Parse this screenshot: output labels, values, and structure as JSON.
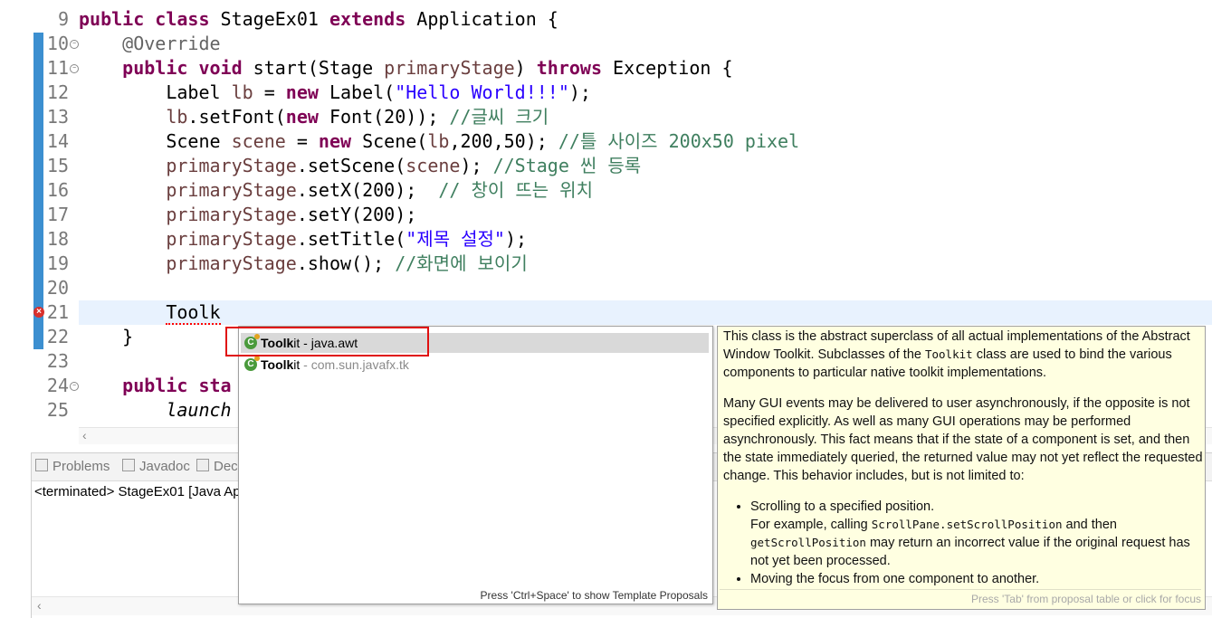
{
  "editor": {
    "lines": [
      {
        "num": "9",
        "segs": [
          {
            "t": "public class",
            "c": "kw"
          },
          {
            "t": " StageEx01 "
          },
          {
            "t": "extends",
            "c": "kw"
          },
          {
            "t": " Application {"
          }
        ]
      },
      {
        "num": "10",
        "segs": [
          {
            "t": "    "
          },
          {
            "t": "@Override",
            "c": "ann"
          }
        ]
      },
      {
        "num": "11",
        "segs": [
          {
            "t": "    "
          },
          {
            "t": "public void",
            "c": "kw"
          },
          {
            "t": " start(Stage "
          },
          {
            "t": "primaryStage",
            "c": "var"
          },
          {
            "t": ") "
          },
          {
            "t": "throws",
            "c": "kw"
          },
          {
            "t": " Exception {"
          }
        ]
      },
      {
        "num": "12",
        "segs": [
          {
            "t": "        Label "
          },
          {
            "t": "lb",
            "c": "var"
          },
          {
            "t": " = "
          },
          {
            "t": "new",
            "c": "kw"
          },
          {
            "t": " Label("
          },
          {
            "t": "\"Hello World!!!\"",
            "c": "str"
          },
          {
            "t": ");"
          }
        ]
      },
      {
        "num": "13",
        "segs": [
          {
            "t": "        "
          },
          {
            "t": "lb",
            "c": "var"
          },
          {
            "t": ".setFont("
          },
          {
            "t": "new",
            "c": "kw"
          },
          {
            "t": " Font(20)); "
          },
          {
            "t": "//글씨 크기",
            "c": "cmt"
          }
        ]
      },
      {
        "num": "14",
        "segs": [
          {
            "t": "        Scene "
          },
          {
            "t": "scene",
            "c": "var"
          },
          {
            "t": " = "
          },
          {
            "t": "new",
            "c": "kw"
          },
          {
            "t": " Scene("
          },
          {
            "t": "lb",
            "c": "var"
          },
          {
            "t": ",200,50); "
          },
          {
            "t": "//틀 사이즈 200x50 pixel",
            "c": "cmt"
          }
        ]
      },
      {
        "num": "15",
        "segs": [
          {
            "t": "        "
          },
          {
            "t": "primaryStage",
            "c": "var"
          },
          {
            "t": ".setScene("
          },
          {
            "t": "scene",
            "c": "var"
          },
          {
            "t": "); "
          },
          {
            "t": "//Stage 씬 등록",
            "c": "cmt"
          }
        ]
      },
      {
        "num": "16",
        "segs": [
          {
            "t": "        "
          },
          {
            "t": "primaryStage",
            "c": "var"
          },
          {
            "t": ".setX(200);  "
          },
          {
            "t": "// 창이 뜨는 위치",
            "c": "cmt"
          }
        ]
      },
      {
        "num": "17",
        "segs": [
          {
            "t": "        "
          },
          {
            "t": "primaryStage",
            "c": "var"
          },
          {
            "t": ".setY(200);"
          }
        ]
      },
      {
        "num": "18",
        "segs": [
          {
            "t": "        "
          },
          {
            "t": "primaryStage",
            "c": "var"
          },
          {
            "t": ".setTitle("
          },
          {
            "t": "\"제목 설정\"",
            "c": "str"
          },
          {
            "t": ");"
          }
        ]
      },
      {
        "num": "19",
        "segs": [
          {
            "t": "        "
          },
          {
            "t": "primaryStage",
            "c": "var"
          },
          {
            "t": ".show(); "
          },
          {
            "t": "//화면에 보이기",
            "c": "cmt"
          }
        ]
      },
      {
        "num": "20",
        "segs": []
      },
      {
        "num": "21",
        "segs": [
          {
            "t": "        "
          },
          {
            "t": "Toolk",
            "c": "squiggle"
          }
        ]
      },
      {
        "num": "22",
        "segs": [
          {
            "t": "    }"
          }
        ]
      },
      {
        "num": "23",
        "segs": []
      },
      {
        "num": "24",
        "segs": [
          {
            "t": "    "
          },
          {
            "t": "public sta",
            "c": "kw"
          }
        ]
      },
      {
        "num": "25",
        "segs": [
          {
            "t": "        "
          },
          {
            "t": "launch",
            "c": "ital"
          }
        ]
      }
    ]
  },
  "bottom_panel": {
    "tabs": [
      {
        "label": "Problems",
        "icon": "problems-icon"
      },
      {
        "label": "Javadoc",
        "icon": "javadoc-icon"
      },
      {
        "label": "Decl",
        "icon": "declaration-icon"
      }
    ],
    "console_text": "<terminated> StageEx01 [Java Ap"
  },
  "proposals": {
    "items": [
      {
        "bold": "Toolk",
        "rest": "it",
        "sep": " - ",
        "qualifier": "java.awt",
        "icon": "class-icon",
        "selected": true
      },
      {
        "bold": "Toolk",
        "rest": "it",
        "sep": " - ",
        "qualifier": "com.sun.javafx.tk",
        "icon": "class-icon",
        "selected": false
      }
    ],
    "footer": "Press 'Ctrl+Space' to show Template Proposals"
  },
  "javadoc_popup": {
    "p1_a": "This class is the abstract superclass of all actual implementations of the Abstract Window Toolkit. Subclasses of the ",
    "p1_code": "Toolkit",
    "p1_b": " class are used to bind the various components to particular native toolkit implementations.",
    "p2": "Many GUI events may be delivered to user asynchronously, if the opposite is not specified explicitly. As well as many GUI operations may be performed asynchronously. This fact means that if the state of a component is set, and then the state immediately queried, the returned value may not yet reflect the requested change. This behavior includes, but is not limited to:",
    "li1_a": "Scrolling to a specified position.",
    "li1_b": "For example, calling ",
    "li1_code1": "ScrollPane.setScrollPosition",
    "li1_c": " and then ",
    "li1_code2": "getScrollPosition",
    "li1_d": " may return an incorrect value if the original request has not yet been processed.",
    "li2": "Moving the focus from one component to another.",
    "footer": "Press 'Tab' from proposal table or click for focus"
  }
}
